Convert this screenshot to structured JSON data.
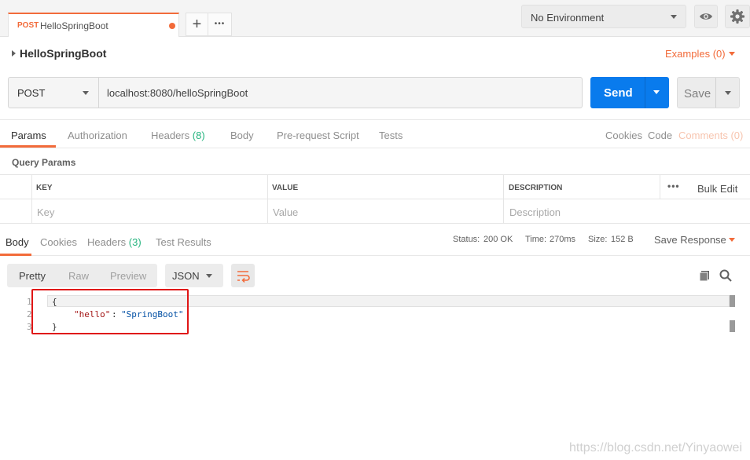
{
  "tab": {
    "method": "POST",
    "name": "HelloSpringBoot"
  },
  "tab_actions": {
    "add": "+",
    "more": "•••"
  },
  "environment": {
    "selected": "No Environment"
  },
  "request": {
    "name": "HelloSpringBoot",
    "examples_label": "Examples (0)",
    "method": "POST",
    "url": "localhost:8080/helloSpringBoot",
    "send_label": "Send",
    "save_label": "Save"
  },
  "request_tabs": [
    {
      "label": "Params"
    },
    {
      "label": "Authorization"
    },
    {
      "label": "Headers"
    },
    {
      "label": "Body"
    },
    {
      "label": "Pre-request Script"
    },
    {
      "label": "Tests"
    }
  ],
  "request_headers_count": "(8)",
  "request_links": {
    "cookies": "Cookies",
    "code": "Code",
    "comments": "Comments (0)"
  },
  "query_params": {
    "title": "Query Params",
    "columns": [
      "KEY",
      "VALUE",
      "DESCRIPTION"
    ],
    "placeholders": [
      "Key",
      "Value",
      "Description"
    ],
    "more": "•••",
    "bulk_edit": "Bulk Edit"
  },
  "response_tabs": [
    {
      "label": "Body"
    },
    {
      "label": "Cookies"
    },
    {
      "label": "Headers"
    },
    {
      "label": "Test Results"
    }
  ],
  "response_headers_count": "(3)",
  "response_status": {
    "status_label": "Status:",
    "status_value": "200 OK",
    "time_label": "Time:",
    "time_value": "270ms",
    "size_label": "Size:",
    "size_value": "152 B",
    "save_response": "Save Response"
  },
  "response_view": {
    "formats": [
      "Pretty",
      "Raw",
      "Preview"
    ],
    "language": "JSON"
  },
  "response_body": {
    "line_numbers": [
      "1",
      "2",
      "3"
    ],
    "open_brace": "{",
    "key": "\"hello\"",
    "colon": ":",
    "value": "\"SpringBoot\"",
    "close_brace": "}"
  },
  "watermark": "https://blog.csdn.net/Yinyaowei",
  "colors": {
    "accent": "#f26b3a",
    "send": "#097bed",
    "status_green": "#26b47f",
    "annotation": "#e01616"
  }
}
